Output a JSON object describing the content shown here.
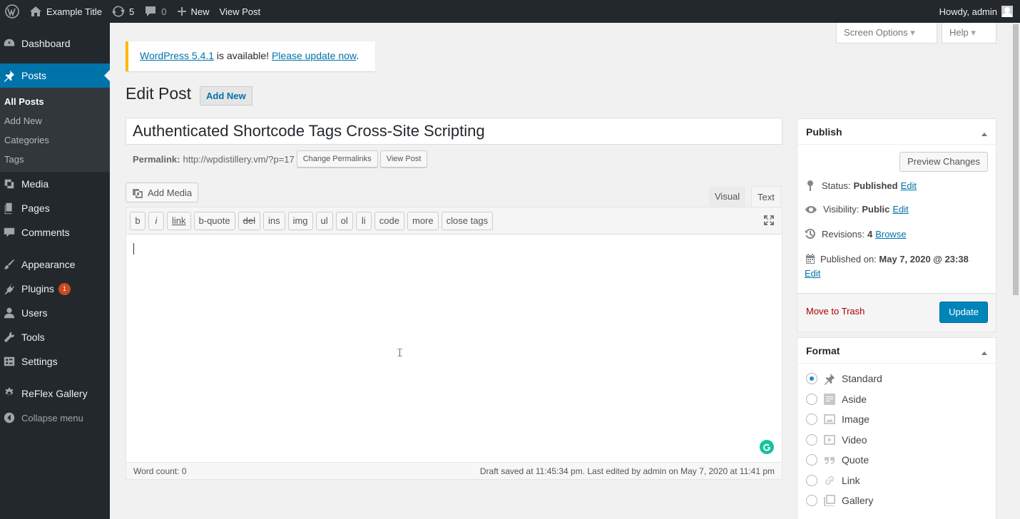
{
  "adminbar": {
    "site_title": "Example Title",
    "updates_count": "5",
    "comments_count": "0",
    "new_label": "New",
    "view_post_label": "View Post",
    "howdy": "Howdy, admin"
  },
  "sidebar": {
    "dashboard": "Dashboard",
    "posts": "Posts",
    "posts_sub": [
      "All Posts",
      "Add New",
      "Categories",
      "Tags"
    ],
    "media": "Media",
    "pages": "Pages",
    "comments": "Comments",
    "appearance": "Appearance",
    "plugins": "Plugins",
    "plugins_badge": "1",
    "users": "Users",
    "tools": "Tools",
    "settings": "Settings",
    "reflex": "ReFlex Gallery",
    "collapse": "Collapse menu"
  },
  "header": {
    "screen_options": "Screen Options",
    "help": "Help"
  },
  "notice": {
    "link1": "WordPress 5.4.1",
    "text": " is available! ",
    "link2": "Please update now",
    "end": "."
  },
  "page": {
    "title": "Edit Post",
    "add_new": "Add New"
  },
  "post": {
    "title": "Authenticated Shortcode Tags Cross-Site Scripting",
    "permalink_label": "Permalink:",
    "permalink_url": "http://wpdistillery.vm/?p=17",
    "change_permalinks": "Change Permalinks",
    "view_post": "View Post"
  },
  "editor": {
    "add_media": "Add Media",
    "tab_visual": "Visual",
    "tab_text": "Text",
    "buttons": [
      "b",
      "i",
      "link",
      "b-quote",
      "del",
      "ins",
      "img",
      "ul",
      "ol",
      "li",
      "code",
      "more",
      "close tags"
    ],
    "word_count": "Word count: 0",
    "draft_status": "Draft saved at 11:45:34 pm. Last edited by admin on May 7, 2020 at 11:41 pm"
  },
  "publish": {
    "title": "Publish",
    "preview": "Preview Changes",
    "status_label": "Status:",
    "status_value": "Published",
    "visibility_label": "Visibility:",
    "visibility_value": "Public",
    "revisions_label": "Revisions:",
    "revisions_value": "4",
    "browse": "Browse",
    "published_label": "Published on:",
    "published_value": "May 7, 2020 @ 23:38",
    "edit": "Edit",
    "trash": "Move to Trash",
    "update": "Update"
  },
  "format": {
    "title": "Format",
    "options": [
      "Standard",
      "Aside",
      "Image",
      "Video",
      "Quote",
      "Link",
      "Gallery"
    ],
    "selected": "Standard"
  }
}
